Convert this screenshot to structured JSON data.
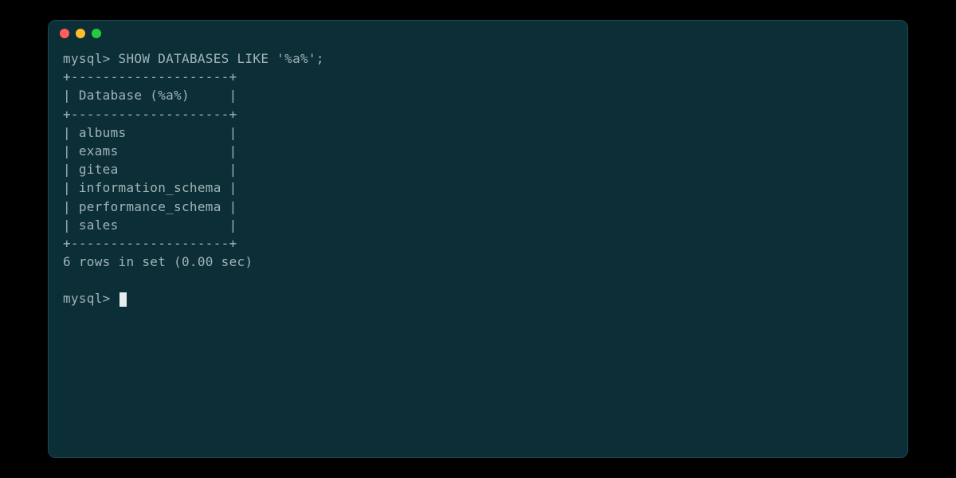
{
  "terminal": {
    "prompt": "mysql>",
    "command": "SHOW DATABASES LIKE '%a%';",
    "table": {
      "border_top": "+--------------------+",
      "header": "| Database (%a%)     |",
      "border_mid": "+--------------------+",
      "rows": [
        "| albums             |",
        "| exams              |",
        "| gitea              |",
        "| information_schema |",
        "| performance_schema |",
        "| sales              |"
      ],
      "border_bottom": "+--------------------+"
    },
    "result_summary": "6 rows in set (0.00 sec)",
    "prompt2": "mysql> "
  }
}
